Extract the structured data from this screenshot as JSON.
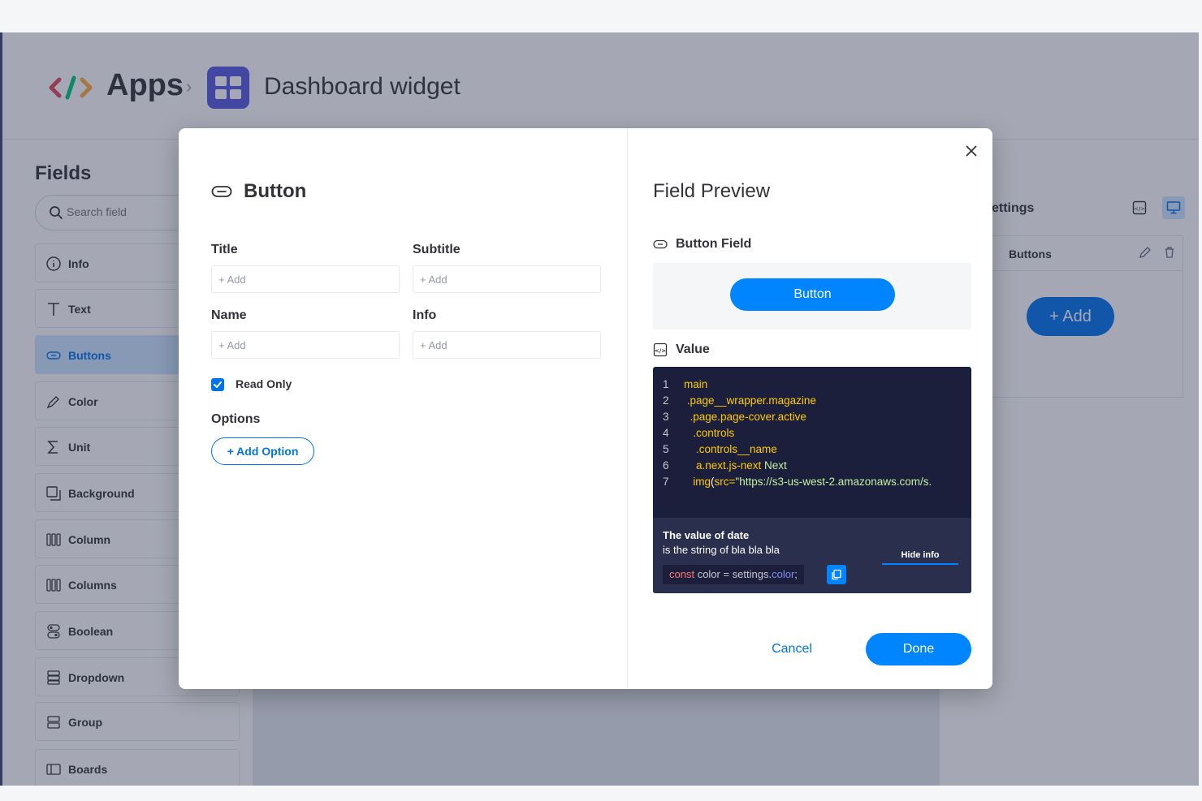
{
  "header": {
    "apps_title": "Apps",
    "breadcrumb_separator": "›",
    "widget_title": "Dashboard widget"
  },
  "sidebar": {
    "title": "Fields",
    "search_placeholder": "Search field",
    "items": [
      {
        "label": "Info",
        "icon": "info-circle-icon"
      },
      {
        "label": "Text",
        "icon": "text-icon"
      },
      {
        "label": "Buttons",
        "icon": "button-pill-icon",
        "active": true
      },
      {
        "label": "Color",
        "icon": "color-picker-icon"
      },
      {
        "label": "Unit",
        "icon": "sigma-icon"
      },
      {
        "label": "Background",
        "icon": "background-icon"
      },
      {
        "label": "Column",
        "icon": "column-icon"
      },
      {
        "label": "Columns",
        "icon": "columns-icon"
      },
      {
        "label": "Boolean",
        "icon": "boolean-icon"
      },
      {
        "label": "Dropdown",
        "icon": "dropdown-icon"
      },
      {
        "label": "Group",
        "icon": "group-icon"
      },
      {
        "label": "Boards",
        "icon": "boards-icon"
      }
    ]
  },
  "settings": {
    "title": "ettings",
    "row_label": "Buttons",
    "add_label": "+ Add"
  },
  "modal": {
    "title": "Button",
    "fields": {
      "title_label": "Title",
      "subtitle_label": "Subtitle",
      "name_label": "Name",
      "info_label": "Info",
      "placeholder": "+ Add"
    },
    "read_only_label": "Read Only",
    "read_only_checked": true,
    "options_label": "Options",
    "add_option_label": "+ Add Option",
    "preview": {
      "title": "Field Preview",
      "button_field_label": "Button Field",
      "button_label": "Button",
      "value_label": "Value",
      "code": [
        {
          "n": "1",
          "parts": [
            {
              "t": "main",
              "c": "y"
            }
          ]
        },
        {
          "n": "2",
          "parts": [
            {
              "t": " .page__wrapper.magazine",
              "c": "y"
            }
          ]
        },
        {
          "n": "3",
          "parts": [
            {
              "t": "  .page.page-cover.active",
              "c": "y"
            }
          ]
        },
        {
          "n": "4",
          "parts": [
            {
              "t": "   .controls",
              "c": "y"
            }
          ]
        },
        {
          "n": "5",
          "parts": [
            {
              "t": "    .controls__name",
              "c": "y"
            }
          ]
        },
        {
          "n": "6",
          "parts": [
            {
              "t": "    a.next.js-next",
              "c": "y"
            },
            {
              "t": " Next",
              "c": "g"
            }
          ]
        },
        {
          "n": "7",
          "parts": [
            {
              "t": "   img",
              "c": "y"
            },
            {
              "t": "(",
              "c": "w"
            },
            {
              "t": "src=",
              "c": "y"
            },
            {
              "t": "\"https://s3-us-west-2.amazonaws.com/s.",
              "c": "g"
            }
          ]
        }
      ],
      "info_title": "The value of date",
      "info_sub": "is the string of bla bla bla",
      "hide_info": "Hide info",
      "snippet_kw": "const",
      "snippet_mid": " color = settings.",
      "snippet_prop": "color",
      "snippet_end": ";"
    },
    "cancel_label": "Cancel",
    "done_label": "Done"
  },
  "colors": {
    "primary": "#0073ea",
    "preview_button": "#0085ff",
    "widget_icon_bg": "#5559df",
    "code_bg": "#1c1f3b",
    "code_foot_bg": "#292f4c",
    "active_item_bg": "#cce5ff"
  }
}
